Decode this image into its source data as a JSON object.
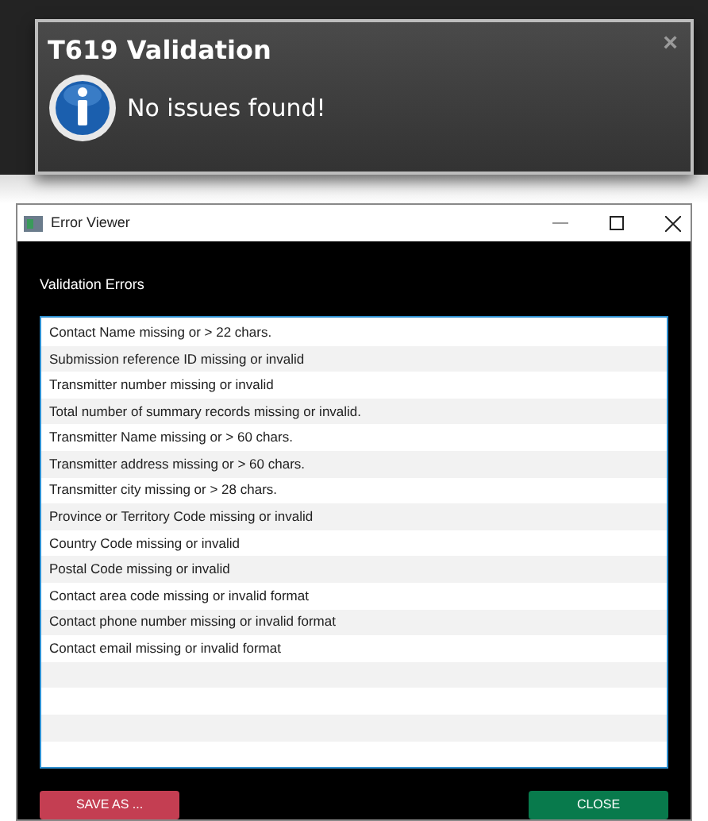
{
  "notification": {
    "title": "T619 Validation",
    "message": "No issues found!",
    "close": "×"
  },
  "window": {
    "title": "Error Viewer"
  },
  "heading": "Validation Errors",
  "errors": [
    "Contact Name missing or > 22 chars.",
    "Submission reference ID missing or invalid",
    "Transmitter number missing or invalid",
    "Total number of summary records missing or invalid.",
    "Transmitter Name missing or > 60 chars.",
    "Transmitter address missing or > 60 chars.",
    "Transmitter city missing or > 28 chars.",
    "Province or Territory Code missing or invalid",
    "Country Code missing or invalid",
    "Postal Code missing or invalid",
    "Contact area code missing or invalid format",
    "Contact phone number missing or invalid format",
    "Contact email missing or invalid format"
  ],
  "buttons": [
    {
      "label": "SAVE AS ...",
      "kind": "save"
    },
    {
      "label": "CLOSE",
      "kind": "close"
    }
  ]
}
